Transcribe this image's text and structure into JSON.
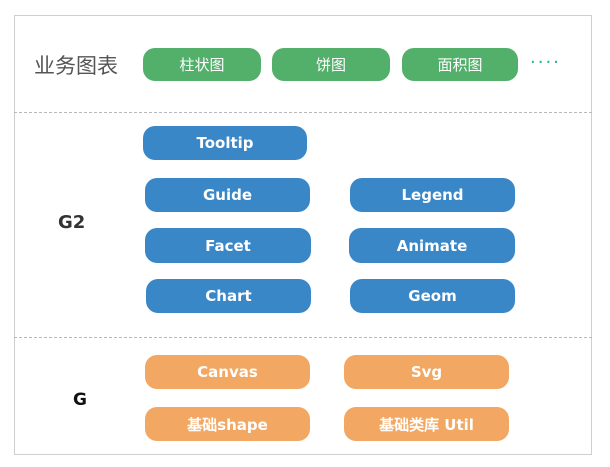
{
  "layers": {
    "business": {
      "label": "业务图表",
      "items": [
        "柱状图",
        "饼图",
        "面积图"
      ],
      "more": "····"
    },
    "g2": {
      "label": "G2",
      "items": [
        "Tooltip",
        "Guide",
        "Legend",
        "Facet",
        "Animate",
        "Chart",
        "Geom"
      ]
    },
    "g": {
      "label": "G",
      "items": [
        "Canvas",
        "Svg",
        "基础shape",
        "基础类库 Util"
      ]
    }
  },
  "colors": {
    "business": "#52b06a",
    "g2": "#3a87c8",
    "g": "#f2a762",
    "ellipsis": "#2bb28a"
  }
}
